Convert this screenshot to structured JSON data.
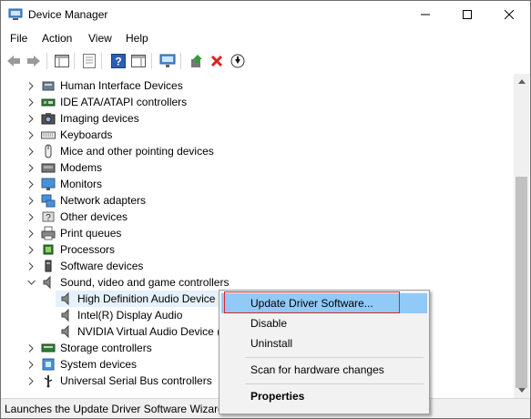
{
  "window": {
    "title": "Device Manager"
  },
  "menu": [
    "File",
    "Action",
    "View",
    "Help"
  ],
  "tree": {
    "categories_top": [
      "Human Interface Devices",
      "IDE ATA/ATAPI controllers",
      "Imaging devices",
      "Keyboards",
      "Mice and other pointing devices",
      "Modems",
      "Monitors",
      "Network adapters",
      "Other devices",
      "Print queues",
      "Processors",
      "Software devices",
      "Sound, video and game controllers"
    ],
    "sound_children": [
      "High Definition Audio Device",
      "Intel(R) Display Audio",
      "NVIDIA Virtual Audio Device ("
    ],
    "categories_bottom": [
      "Storage controllers",
      "System devices",
      "Universal Serial Bus controllers"
    ]
  },
  "context_menu": {
    "update": "Update Driver Software...",
    "disable": "Disable",
    "uninstall": "Uninstall",
    "scan": "Scan for hardware changes",
    "properties": "Properties"
  },
  "status": {
    "text": "Launches the Update Driver Software Wizard for the selected device."
  },
  "colors": {
    "highlight": "#91c9f7",
    "selection": "#e5f1fb",
    "annotation_box": "#d9262c"
  }
}
